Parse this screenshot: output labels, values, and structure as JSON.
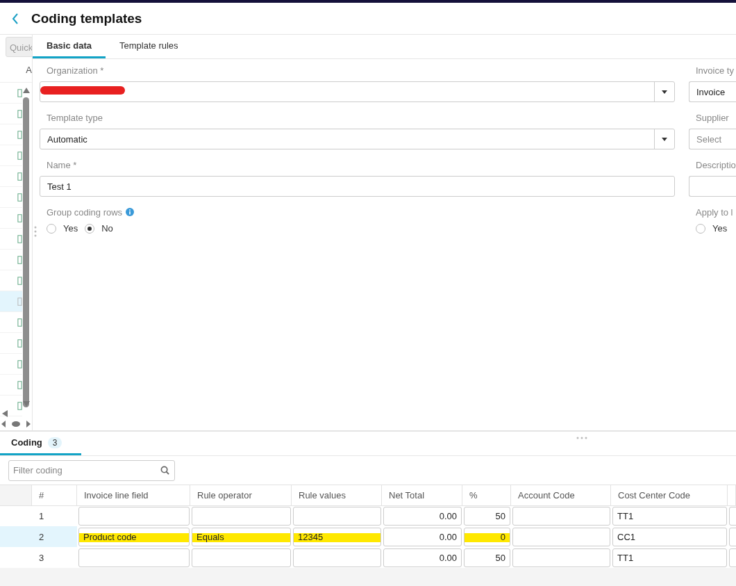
{
  "header": {
    "title": "Coding templates"
  },
  "side_list": {
    "search_placeholder": "Quick",
    "column": "A",
    "rows": [
      {
        "selected": false
      },
      {
        "selected": false
      },
      {
        "selected": false
      },
      {
        "selected": false
      },
      {
        "selected": false
      },
      {
        "selected": false
      },
      {
        "selected": false
      },
      {
        "selected": false
      },
      {
        "selected": false
      },
      {
        "selected": false
      },
      {
        "selected": true
      },
      {
        "selected": false
      },
      {
        "selected": false
      },
      {
        "selected": false
      },
      {
        "selected": false
      },
      {
        "selected": false
      }
    ]
  },
  "tabs": [
    {
      "label": "Basic data",
      "selected": true
    },
    {
      "label": "Template rules",
      "selected": false
    }
  ],
  "form_left": [
    {
      "kind": "select",
      "label": "Organization *",
      "redacted": true
    },
    {
      "kind": "select",
      "label": "Template type",
      "value": "Automatic"
    },
    {
      "kind": "input",
      "label": "Name *",
      "value": "Test 1"
    },
    {
      "kind": "radio",
      "label": "Group coding rows",
      "info": true,
      "options": [
        {
          "label": "Yes",
          "selected": false
        },
        {
          "label": "No",
          "selected": true
        }
      ]
    }
  ],
  "form_right": [
    {
      "kind": "input",
      "label": "Invoice ty",
      "value": "Invoice"
    },
    {
      "kind": "input",
      "label": "Supplier",
      "placeholder": "Select"
    },
    {
      "kind": "input",
      "label": "Descriptio"
    },
    {
      "kind": "radio",
      "label": "Apply to l",
      "options": [
        {
          "label": "Yes",
          "selected": false
        }
      ]
    }
  ],
  "bottom_tabs": [
    {
      "label": "Coding",
      "count": "3",
      "selected": true
    }
  ],
  "filter": {
    "placeholder": "Filter coding"
  },
  "table": {
    "columns": [
      "#",
      "Invoice line field",
      "Rule operator",
      "Rule values",
      "Net Total",
      "%",
      "Account Code",
      "Cost Center Code"
    ],
    "rows": [
      {
        "selected": false,
        "cells": [
          {
            "kind": "number",
            "value": "1"
          },
          {
            "kind": "text"
          },
          {
            "kind": "text"
          },
          {
            "kind": "text"
          },
          {
            "kind": "amount",
            "value": "0.00"
          },
          {
            "kind": "amount",
            "value": "50"
          },
          {
            "kind": "text"
          },
          {
            "kind": "text",
            "value": "TT1"
          }
        ]
      },
      {
        "selected": true,
        "cells": [
          {
            "kind": "number",
            "value": "2"
          },
          {
            "kind": "text",
            "value": "Product code",
            "highlighted": true
          },
          {
            "kind": "text",
            "value": "Equals",
            "highlighted": true
          },
          {
            "kind": "text",
            "value": "12345",
            "highlighted": true
          },
          {
            "kind": "amount",
            "value": "0.00"
          },
          {
            "kind": "amount",
            "value": "0",
            "highlighted": true
          },
          {
            "kind": "text"
          },
          {
            "kind": "text",
            "value": "CC1"
          }
        ]
      },
      {
        "selected": false,
        "cells": [
          {
            "kind": "number",
            "value": "3"
          },
          {
            "kind": "text"
          },
          {
            "kind": "text"
          },
          {
            "kind": "text"
          },
          {
            "kind": "amount",
            "value": "0.00"
          },
          {
            "kind": "amount",
            "value": "50"
          },
          {
            "kind": "text"
          },
          {
            "kind": "text",
            "value": "TT1"
          }
        ]
      }
    ]
  }
}
